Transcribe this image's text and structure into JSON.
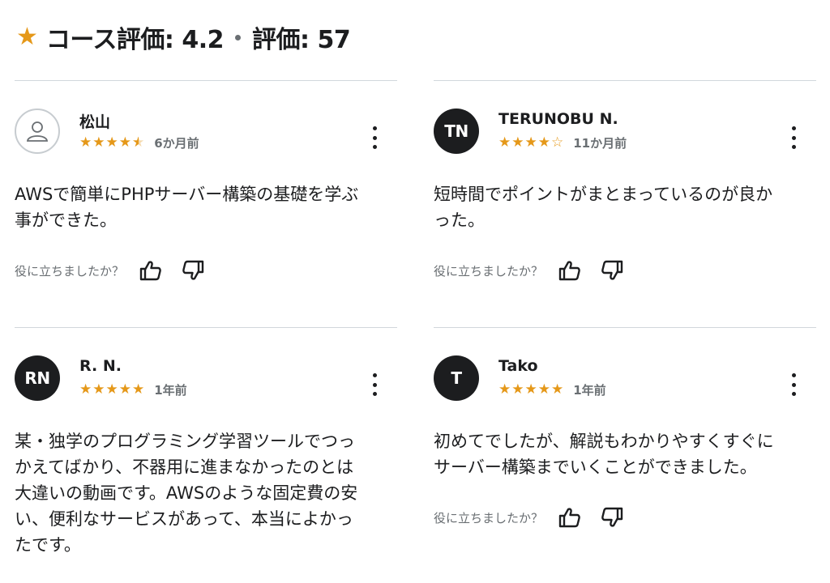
{
  "header": {
    "star_icon": "star-icon",
    "title": "コース評価: 4.2",
    "ratings_count_label": "評価: 57",
    "accent_color": "#e59819"
  },
  "reviews": [
    {
      "name": "松山",
      "avatar_initials": "",
      "avatar_type": "default-user-icon",
      "rating": 4.5,
      "date": "6か月前",
      "text": "AWSで簡単にPHPサーバー構築の基礎を学ぶ\n事ができた。",
      "helpful_question": "役に立ちましたか？"
    },
    {
      "name": "TERUNOBU N.",
      "avatar_initials": "TN",
      "avatar_type": "initials",
      "rating": 4,
      "date": "11か月前",
      "text": "短時間でポイントがまとまっているのが良か\nった。",
      "helpful_question": "役に立ちましたか？"
    },
    {
      "name": "R. N.",
      "avatar_initials": "RN",
      "avatar_type": "initials",
      "rating": 5,
      "date": "1年前",
      "text": "某・独学のプログラミング学習ツールでつっ\nかえてばかり、不器用に進まなかったのとは\n大違いの動画です。AWSのような固定費の安\nい、便利なサービスがあって、本当によかっ\nたです。",
      "helpful_question": ""
    },
    {
      "name": "Tako",
      "avatar_initials": "T",
      "avatar_type": "initials",
      "rating": 5,
      "date": "1年前",
      "text": "初めてでしたが、解説もわかりやすくすぐに\nサーバー構築までいくことができました。",
      "helpful_question": "役に立ちましたか？"
    }
  ]
}
